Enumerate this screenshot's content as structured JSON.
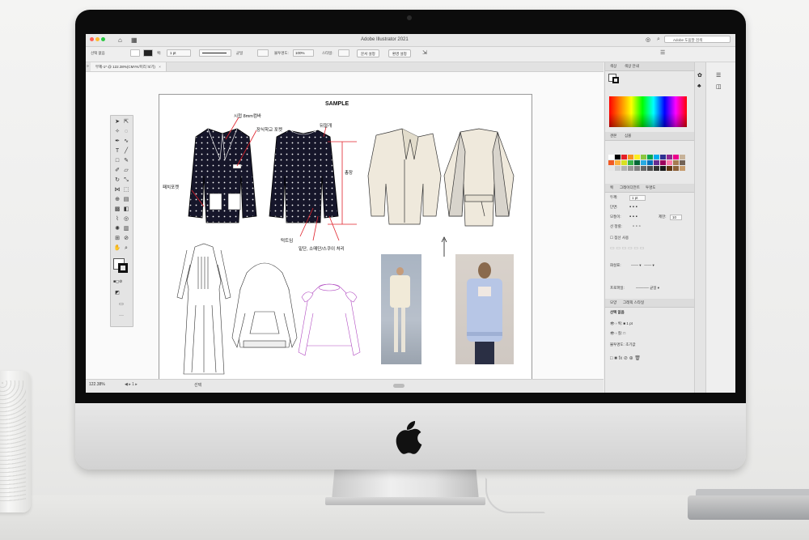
{
  "app": {
    "window_title": "Adobe Illustrator 2021",
    "search_placeholder": "Adobe 도움말 검색",
    "document_tab": "무제-1* @ 122.38%(CMYK/미리 보기)",
    "zoom_level": "122.38%",
    "status_text": "선택"
  },
  "control_bar": {
    "selection_label": "선택 없음",
    "stroke_label": "획:",
    "stroke_weight": "1 pt",
    "stroke_profile": "균일",
    "opacity_label": "불투명도:",
    "opacity_value": "100%",
    "style_label": "스타일:",
    "doc_setup_button": "문서 설정",
    "preferences_button": "환경 설정"
  },
  "artboard": {
    "title": "SAMPLE",
    "annotations": {
      "stitch": "시접 8mm컴바",
      "welt_pocket": "장식학교 포켓",
      "shoulder": "뒤절개",
      "patch_pocket": "패치포켓",
      "length": "총장",
      "dart": "턱트임",
      "hem": "밑단, 소매단/스쿠이 처리"
    }
  },
  "panels": {
    "color_tabs": [
      "색상",
      "색상 안내"
    ],
    "swatch_tabs": [
      "견본",
      "심볼"
    ],
    "stroke_tabs": [
      "획",
      "그레이디언트",
      "투명도"
    ],
    "stroke_rows": {
      "weight_label": "두께:",
      "weight_value": "1 pt",
      "cap_label": "단면:",
      "corner_label": "모퉁이:",
      "limit_label": "제한:",
      "limit_value": "10",
      "align_label": "선 정렬:",
      "dashed_label": "점선 사용",
      "arrow_label": "화살표:",
      "profile_label": "프로파일:",
      "profile_value": "균일"
    },
    "layer_tabs": [
      "모양",
      "그래픽 스타일"
    ],
    "appearance": {
      "header": "선택 없음",
      "stroke_row": "획:",
      "stroke_value": "1 pt",
      "fill_row": "칠:",
      "opacity_row": "불투명도:",
      "opacity_value": "초기값"
    }
  },
  "colors": {
    "bezel": "#0c0c0c",
    "chassis": "#e2e2e2",
    "jacket": "#1a1a2a",
    "coat": "#efe9dc",
    "annotation_red": "#e0202a"
  }
}
